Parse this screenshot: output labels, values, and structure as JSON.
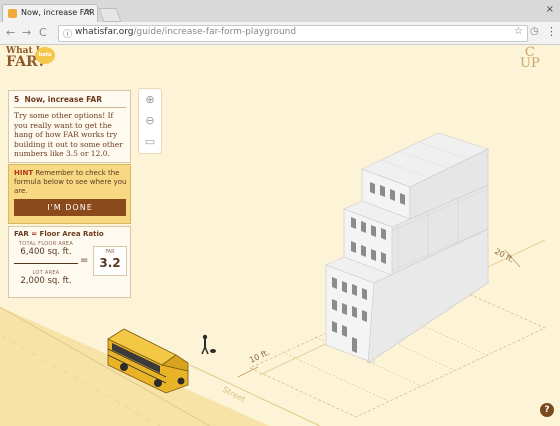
{
  "browser": {
    "tab_title": "Now, increase FAR",
    "tab_close": "×",
    "window_close": "×",
    "url_domain": "whatisfar.org",
    "url_path": "/guide/increase-far-form-playground",
    "back": "←",
    "forward": "→",
    "reload": "C",
    "info": "ⓘ",
    "star": "☆",
    "ext": "◷",
    "menu": "⋮"
  },
  "logo": {
    "line1": "What Is",
    "line2": "FAR?",
    "badge": "beta"
  },
  "cup_logo": {
    "top": "C",
    "bottom": "UP"
  },
  "zoom": {
    "in": "⊕",
    "out": "⊖",
    "tilt": "▭"
  },
  "lesson": {
    "number": "5",
    "title": "Now, increase FAR",
    "body": "Try some other options! If you really want to get the hang of how FAR works try building it out to some other numbers like 3.5 or 12.0."
  },
  "hint": {
    "label": "HINT",
    "text": "Remember to check the formula below to see where you are.",
    "button": "I'M DONE"
  },
  "far": {
    "title_abbr": "FAR",
    "title_eq": "=",
    "title_full": "Floor Area Ratio",
    "total_floor_area_label": "TOTAL FLOOR AREA",
    "total_floor_area_value": "6,400 sq. ft.",
    "lot_area_label": "LOT AREA",
    "lot_area_value": "2,000 sq. ft.",
    "equals": "=",
    "result_label": "FAR",
    "result_value": "3.2"
  },
  "scene": {
    "dim_10": "10 ft.",
    "dim_20": "20 ft.",
    "street": "Street"
  },
  "help": "?"
}
